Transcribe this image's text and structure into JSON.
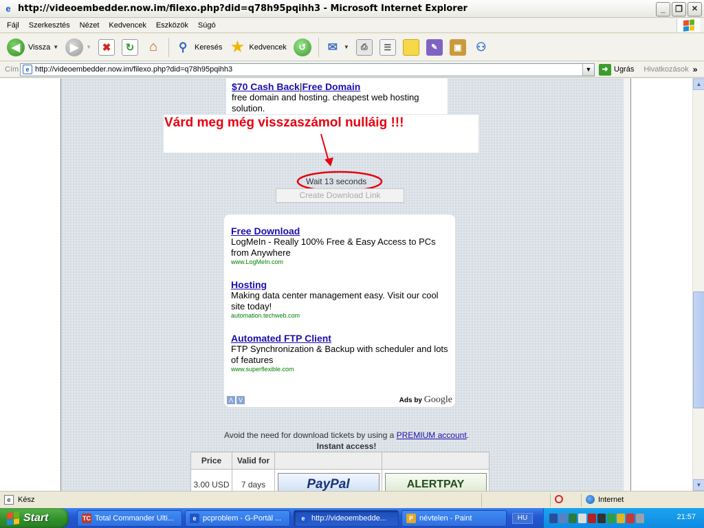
{
  "window": {
    "title": "http://videoembedder.now.im/filexo.php?did=q78h95pqihh3 - Microsoft Internet Explorer",
    "btn_min": "_",
    "btn_max": "❐",
    "btn_close": "✕"
  },
  "menu": {
    "items": [
      "Fájl",
      "Szerkesztés",
      "Nézet",
      "Kedvencek",
      "Eszközök",
      "Súgó"
    ]
  },
  "toolbar": {
    "back_label": "Vissza",
    "search_label": "Keresés",
    "favorites_label": "Kedvencek"
  },
  "address": {
    "label": "Cím",
    "url": "http://videoembedder.now.im/filexo.php?did=q78h95pqihh3",
    "go_label": "Ugrás",
    "links_label": "Hivatkozások"
  },
  "page": {
    "top_ad": {
      "link_a": "$70 Cash Back",
      "link_b": "Free Domain",
      "desc": "free domain and hosting. cheapest web hosting solution."
    },
    "annotation": "Várd meg még visszaszámol nulláig !!!",
    "wait_text": "Wait 13 seconds",
    "create_button": "Create Download Link",
    "ads": [
      {
        "title": "Free Download",
        "desc": "LogMeIn - Really 100% Free & Easy Access to PCs from Anywhere",
        "url": "www.LogMeIn.com"
      },
      {
        "title": "Hosting",
        "desc": "Making data center management easy. Visit our cool site today!",
        "url": "automation.techweb.com"
      },
      {
        "title": "Automated FTP Client",
        "desc": "FTP Synchronization & Backup with scheduler and lots of features",
        "url": "www.superflexible.com"
      }
    ],
    "ads_by": "Ads by",
    "ads_by_brand": "Google",
    "premium_prefix": "Avoid the need for download tickets by using a",
    "premium_link": "PREMIUM account",
    "premium_suffix": ".",
    "instant": "Instant access!",
    "table": {
      "headers": [
        "Price",
        "Valid for",
        "",
        ""
      ],
      "row": [
        "3.00 USD",
        "7 days"
      ],
      "paypal": "PayPal",
      "alertpay": "ALERTPAY"
    }
  },
  "status": {
    "text": "Kész",
    "zone": "Internet"
  },
  "taskbar": {
    "start": "Start",
    "tasks": [
      "Total Commander Ulti...",
      "pcproblem - G-Portál ...",
      "http://videoembedde...",
      "névtelen - Paint"
    ],
    "lang": "HU",
    "clock": "21:57"
  },
  "colors": {
    "annotation": "#e8000f",
    "ad_link": "#1a0dab",
    "ad_url": "#008000",
    "taskbar": "#2459d6",
    "start": "#2f8f2a"
  }
}
